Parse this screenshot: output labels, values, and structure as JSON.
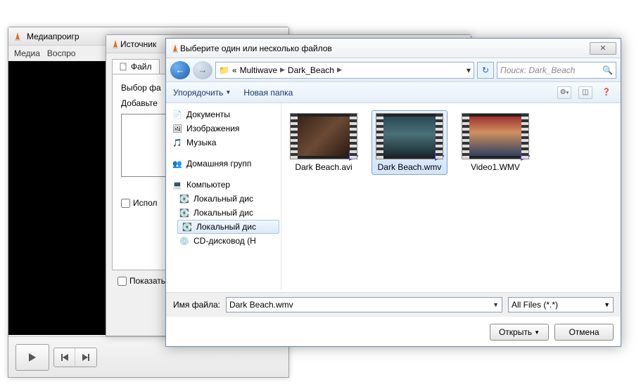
{
  "win1": {
    "title": "Медиапроигр",
    "menu": [
      "Медиа",
      "Воспро"
    ]
  },
  "win2": {
    "title": "Источник",
    "tab": "Файл",
    "label_select": "Выбор фа",
    "label_add": "Добавьте",
    "chk_use": "Испол",
    "chk_show": "Показать"
  },
  "win3": {
    "title": "Выберите один или несколько файлов",
    "breadcrumb": {
      "p1": "Multiwave",
      "p2": "Dark_Beach",
      "prefix": "«"
    },
    "search_placeholder": "Поиск: Dark_Beach",
    "toolbar": {
      "organize": "Упорядочить",
      "newfolder": "Новая папка"
    },
    "tree": {
      "libs": [
        "Документы",
        "Изображения",
        "Музыка"
      ],
      "homegroup": "Домашняя групп",
      "computer": "Компьютер",
      "drives": [
        "Локальный дис",
        "Локальный дис",
        "Локальный дис",
        "CD-дисковод (H"
      ]
    },
    "files": [
      {
        "name": "Dark Beach.avi"
      },
      {
        "name": "Dark Beach.wmv",
        "selected": true
      },
      {
        "name": "Video1.WMV"
      }
    ],
    "filename_label": "Имя файла:",
    "filename_value": "Dark Beach.wmv",
    "filter": "All Files (*.*)",
    "open": "Открыть",
    "cancel": "Отмена"
  }
}
